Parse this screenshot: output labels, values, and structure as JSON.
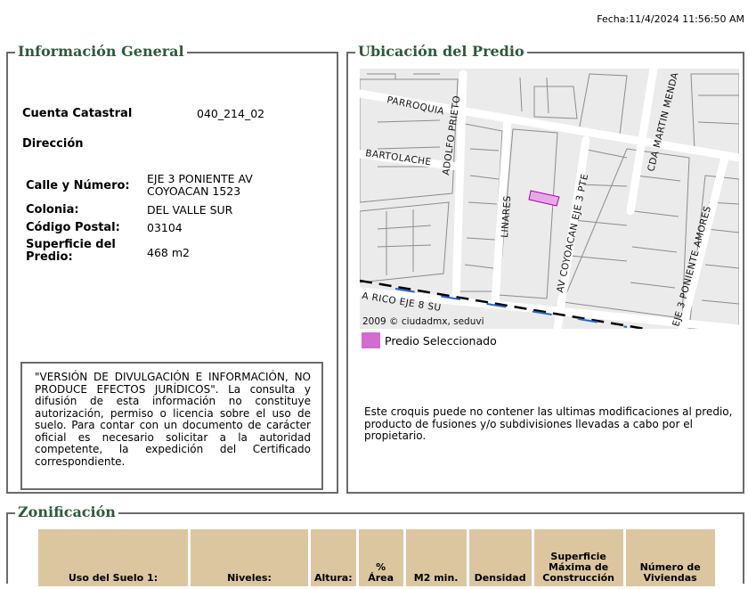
{
  "header": {
    "fecha": "Fecha:11/4/2024 11:56:50 AM"
  },
  "info": {
    "legend": "Información General",
    "cuenta_label": "Cuenta Catastral",
    "cuenta_value": "040_214_02",
    "direccion_label": "Dirección",
    "calle_label": "Calle y Número:",
    "calle_value_line1": "EJE 3 PONIENTE AV",
    "calle_value_line2": "COYOACAN 1523",
    "colonia_label": "Colonia:",
    "colonia_value": "DEL VALLE SUR",
    "cp_label": "Código Postal:",
    "cp_value": "03104",
    "superficie_label_line1": "Superficie del",
    "superficie_label_line2": "Predio:",
    "superficie_value": "468 m2",
    "disclaimer": "\"VERSIÓN DE DIVULGACIÓN E INFORMACIÓN, NO PRODUCE EFECTOS JURÍDICOS\". La consulta y difusión de esta información no constituye autorización, permiso o licencia sobre el uso de suelo. Para contar con un documento de carácter oficial es necesario solicitar a la autoridad competente, la expedición del Certificado correspondiente."
  },
  "ubicacion": {
    "legend": "Ubicación del Predio",
    "map_labels": {
      "parroquia": "PARROQUIA",
      "adolfo_prieto": "ADOLFO PRIETO",
      "bartolache": "BARTOLACHE",
      "linares": "LINARES",
      "coyoacan": "AV COYOACAN EJE 3 PTE",
      "cda_martin": "CDA MARTIN MENDA",
      "eje3_amores": "EJE 3 PONIENTE AMORES",
      "rico_eje8": "A RICO EJE 8 SU"
    },
    "copyright": "2009 © ciudadmx, seduvi",
    "legend_item": "Predio Seleccionado",
    "predio_color": "#d26bd2",
    "note": "Este croquis puede no contener las ultimas modificaciones al predio, producto de fusiones y/o subdivisiones llevadas a cabo por el propietario."
  },
  "zonificacion": {
    "legend": "Zonificación",
    "headers": [
      [
        "Uso del Suelo 1:"
      ],
      [
        "Niveles:"
      ],
      [
        "Altura:"
      ],
      [
        "%",
        "Área"
      ],
      [
        "M2 min."
      ],
      [
        "Densidad"
      ],
      [
        "Superficie",
        "Máxima de",
        "Construcción"
      ],
      [
        "Número de",
        "Viviendas"
      ]
    ]
  }
}
